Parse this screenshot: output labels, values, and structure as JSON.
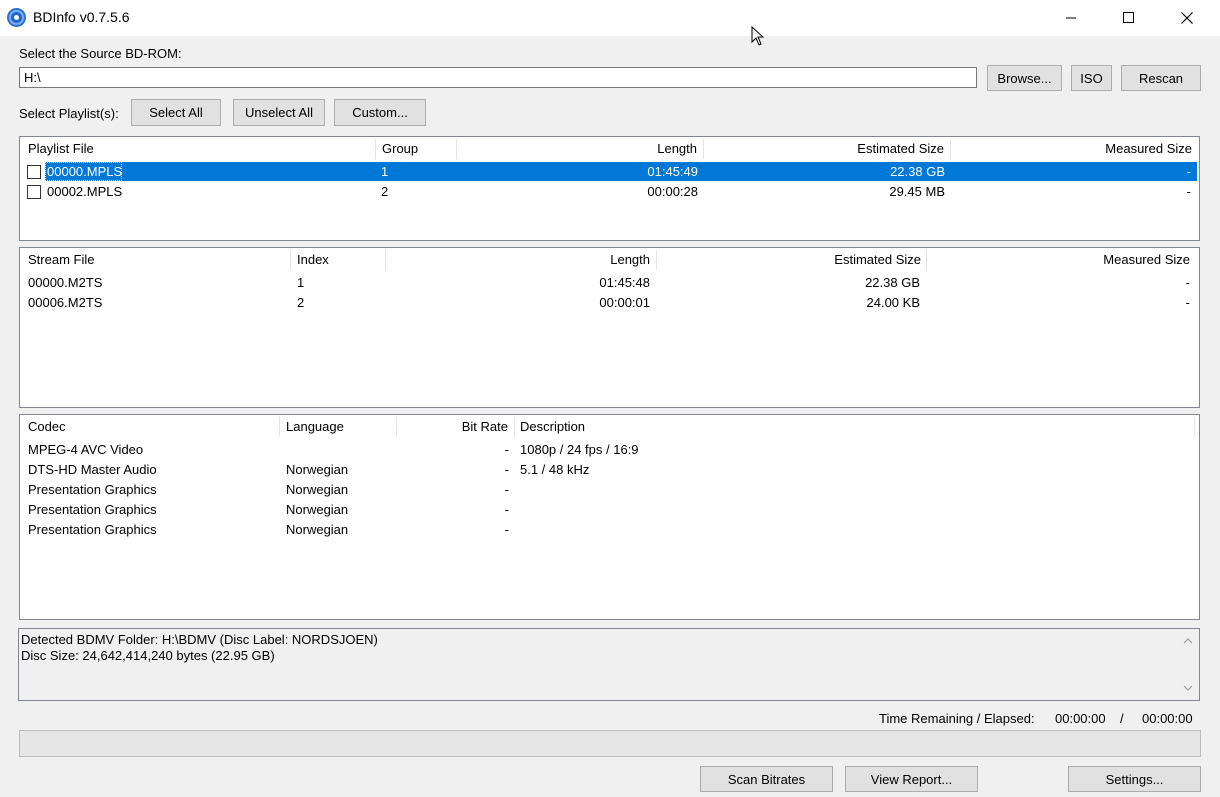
{
  "window": {
    "title": "BDInfo v0.7.5.6"
  },
  "source": {
    "label": "Select the Source BD-ROM:",
    "path": "H:\\",
    "browse": "Browse...",
    "iso": "ISO",
    "rescan": "Rescan"
  },
  "playlist_select": {
    "label": "Select Playlist(s):",
    "select_all": "Select All",
    "unselect_all": "Unselect All",
    "custom": "Custom..."
  },
  "playlists": {
    "headers": [
      "Playlist File",
      "Group",
      "Length",
      "Estimated Size",
      "Measured Size"
    ],
    "rows": [
      {
        "file": "00000.MPLS",
        "group": "1",
        "length": "01:45:49",
        "est": "22.38 GB",
        "meas": "-",
        "selected": true,
        "checked": false
      },
      {
        "file": "00002.MPLS",
        "group": "2",
        "length": "00:00:28",
        "est": "29.45 MB",
        "meas": "-",
        "selected": false,
        "checked": false
      }
    ]
  },
  "streams": {
    "headers": [
      "Stream File",
      "Index",
      "Length",
      "Estimated Size",
      "Measured Size"
    ],
    "rows": [
      {
        "file": "00000.M2TS",
        "index": "1",
        "length": "01:45:48",
        "est": "22.38 GB",
        "meas": "-"
      },
      {
        "file": "00006.M2TS",
        "index": "2",
        "length": "00:00:01",
        "est": "24.00 KB",
        "meas": "-"
      }
    ]
  },
  "codecs": {
    "headers": [
      "Codec",
      "Language",
      "Bit Rate",
      "Description"
    ],
    "rows": [
      {
        "codec": "MPEG-4 AVC Video",
        "language": "",
        "bitrate": "-",
        "desc": "1080p / 24 fps / 16:9"
      },
      {
        "codec": "DTS-HD Master Audio",
        "language": "Norwegian",
        "bitrate": "-",
        "desc": "5.1 / 48 kHz"
      },
      {
        "codec": "Presentation Graphics",
        "language": "Norwegian",
        "bitrate": "-",
        "desc": ""
      },
      {
        "codec": "Presentation Graphics",
        "language": "Norwegian",
        "bitrate": "-",
        "desc": ""
      },
      {
        "codec": "Presentation Graphics",
        "language": "Norwegian",
        "bitrate": "-",
        "desc": ""
      }
    ]
  },
  "log": {
    "line1": "Detected BDMV Folder: H:\\BDMV (Disc Label: NORDSJOEN)",
    "line2": "Disc Size: 24,642,414,240 bytes (22.95 GB)"
  },
  "time": {
    "label": "Time Remaining / Elapsed:",
    "remaining": "00:00:00",
    "sep": "/",
    "elapsed": "00:00:00"
  },
  "progress": {
    "fraction": 0
  },
  "buttons": {
    "scan": "Scan Bitrates",
    "report": "View Report...",
    "settings": "Settings..."
  },
  "colors": {
    "selection": "#0078d7",
    "background": "#f0f0f0"
  },
  "icons": {
    "app": "bluray-disc-icon",
    "minimize": "minimize-icon",
    "maximize": "maximize-icon",
    "close": "close-icon",
    "cursor": "mouse-cursor-icon"
  }
}
